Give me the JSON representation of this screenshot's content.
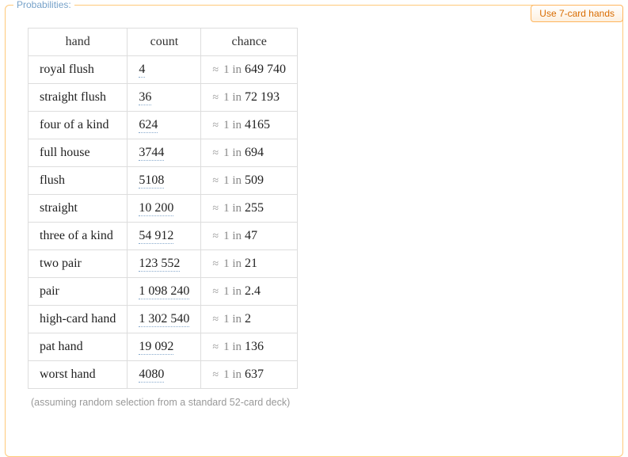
{
  "panel": {
    "title": "Probabilities:",
    "action_label": "Use 7-card hands"
  },
  "table": {
    "headers": {
      "hand": "hand",
      "count": "count",
      "chance": "chance"
    },
    "approx_symbol": "≈",
    "onein_prefix": "1 in",
    "rows": [
      {
        "hand": "royal flush",
        "count": "4",
        "chance": "649 740"
      },
      {
        "hand": "straight flush",
        "count": "36",
        "chance": "72 193"
      },
      {
        "hand": "four of a kind",
        "count": "624",
        "chance": "4165"
      },
      {
        "hand": "full house",
        "count": "3744",
        "chance": "694"
      },
      {
        "hand": "flush",
        "count": "5108",
        "chance": "509"
      },
      {
        "hand": "straight",
        "count": "10 200",
        "chance": "255"
      },
      {
        "hand": "three of a kind",
        "count": "54 912",
        "chance": "47"
      },
      {
        "hand": "two pair",
        "count": "123 552",
        "chance": "21"
      },
      {
        "hand": "pair",
        "count": "1 098 240",
        "chance": "2.4"
      },
      {
        "hand": "high-card hand",
        "count": "1 302 540",
        "chance": "2"
      },
      {
        "hand": "pat hand",
        "count": "19 092",
        "chance": "136"
      },
      {
        "hand": "worst hand",
        "count": "4080",
        "chance": "637"
      }
    ]
  },
  "footnote": "(assuming random selection from a standard 52-card deck)"
}
